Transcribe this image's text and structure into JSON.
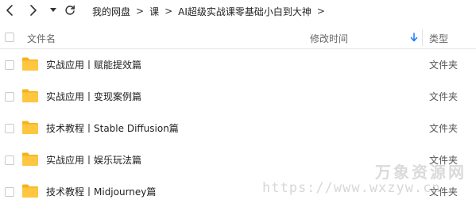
{
  "breadcrumb": [
    {
      "label": "我的网盘"
    },
    {
      "label": "课"
    },
    {
      "label": "AI超级实战课零基础小白到大神"
    }
  ],
  "breadcrumb_trailing_sep": ">",
  "breadcrumb_sep": ">",
  "header": {
    "name": "文件名",
    "modified_time": "修改时间",
    "type": "类型"
  },
  "files": [
    {
      "name": "实战应用丨赋能提效篇",
      "type": "文件夹"
    },
    {
      "name": "实战应用丨变现案例篇",
      "type": "文件夹"
    },
    {
      "name": "技术教程丨Stable Diffusion篇",
      "type": "文件夹"
    },
    {
      "name": "实战应用丨娱乐玩法篇",
      "type": "文件夹"
    },
    {
      "name": "技术教程丨Midjourney篇",
      "type": "文件夹"
    }
  ],
  "watermark": {
    "title": "万象资源网",
    "url": "https://www.wxzyw.cn"
  },
  "colors": {
    "folder": "#FFC63F",
    "folder_tab": "#F5B21C",
    "sort_arrow": "#1677ff"
  },
  "icons": [
    "back-arrow-icon",
    "forward-arrow-icon",
    "dropdown-caret-icon",
    "refresh-icon",
    "sort-desc-icon",
    "folder-icon"
  ]
}
